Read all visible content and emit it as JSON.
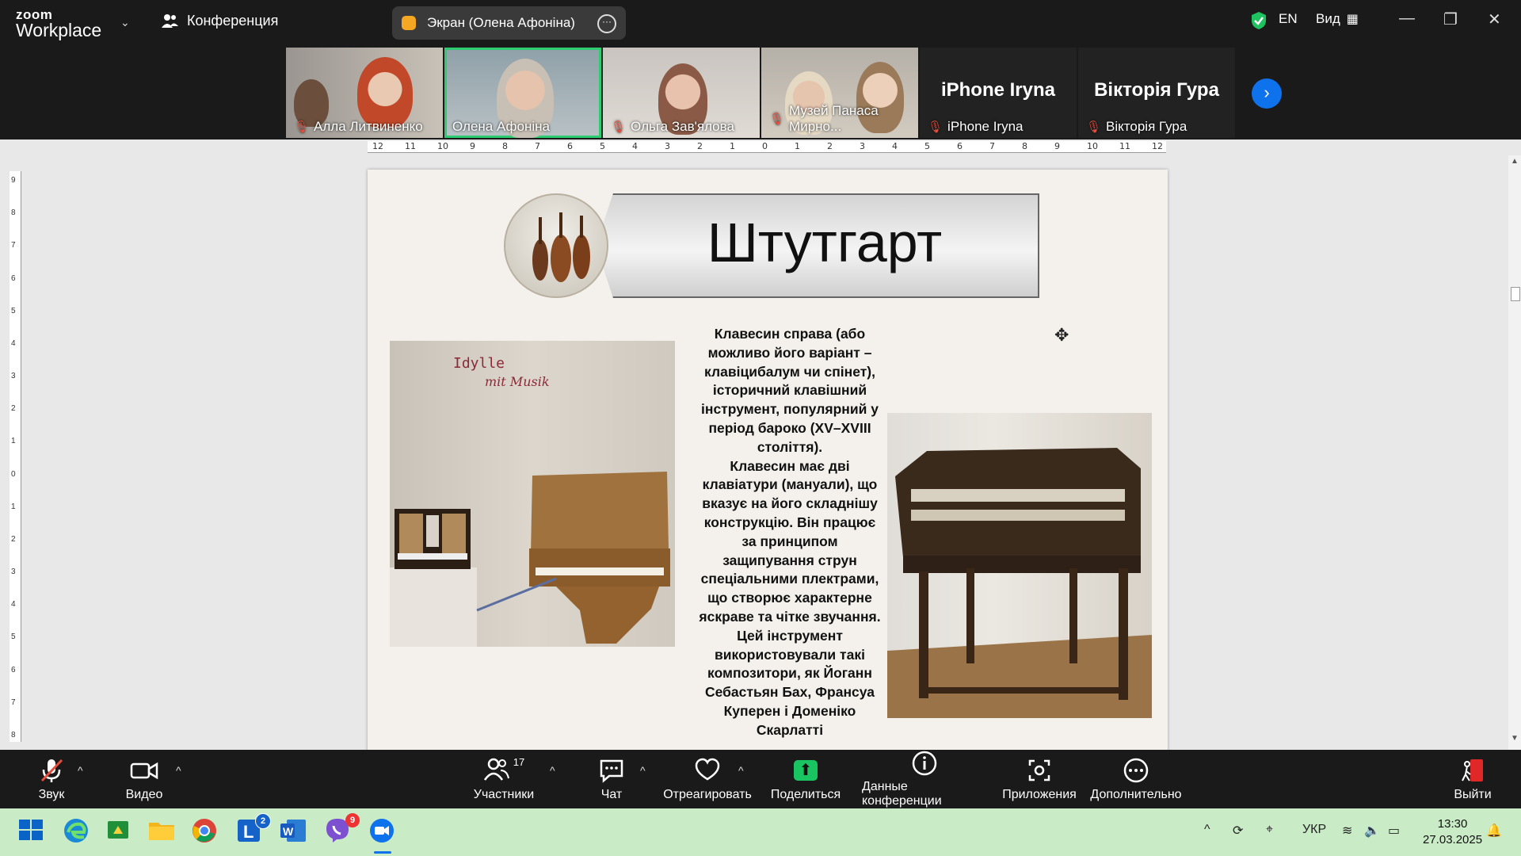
{
  "app": {
    "logo_line1": "zoom",
    "logo_line2": "Workplace",
    "meeting_label": "Конференция",
    "share_pill_text": "Экран (Олена Афоніна)",
    "language": "EN",
    "view_label": "Вид"
  },
  "participants": [
    {
      "name": "Алла Литвиненко",
      "muted": true,
      "video": true
    },
    {
      "name": "Олена Афоніна",
      "muted": false,
      "video": true,
      "active": true
    },
    {
      "name": "Ольга Зав'ялова",
      "muted": true,
      "video": true
    },
    {
      "name": "Музей Панаса Мирно...",
      "muted": true,
      "video": true
    },
    {
      "name": "iPhone Iryna",
      "muted": true,
      "video": false,
      "display": "iPhone Iryna"
    },
    {
      "name": "Вікторія Гура",
      "muted": true,
      "video": false,
      "display": "Вікторія Гура"
    }
  ],
  "document": {
    "title": "Штутгарт",
    "photo_caption_1": "Idylle",
    "photo_caption_2": "mit Musik",
    "body_lines": [
      "Клавесин справа (або",
      "можливо його варіант –",
      "клавіцибалум чи спінет),",
      "історичний клавішний",
      "інструмент, популярний у",
      "період бароко (XV–XVIII",
      "століття).",
      "Клавесин має дві",
      "клавіатури (мануали), що",
      "вказує на його складнішу",
      "конструкцію. Він працює",
      "за принципом",
      "защипування струн",
      "спеціальними плектрами,",
      "що створює характерне",
      "яскраве та чітке звучання.",
      "Цей інструмент",
      "використовували такі",
      "композитори, як Йоганн",
      "Себастьян Бах, Франсуа",
      "Куперен і Доменіко",
      "Скарлатті"
    ]
  },
  "ruler": {
    "h_ticks": [
      "12",
      "11",
      "10",
      "9",
      "8",
      "7",
      "6",
      "5",
      "4",
      "3",
      "2",
      "1",
      "0",
      "1",
      "2",
      "3",
      "4",
      "5",
      "6",
      "7",
      "8",
      "9",
      "10",
      "11",
      "12"
    ],
    "v_ticks": [
      "9",
      "8",
      "7",
      "6",
      "5",
      "4",
      "3",
      "2",
      "1",
      "0",
      "1",
      "2",
      "3",
      "4",
      "5",
      "6",
      "7",
      "8"
    ]
  },
  "toolbar": {
    "audio_label": "Звук",
    "video_label": "Видео",
    "participants_label": "Участники",
    "participants_count": "17",
    "chat_label": "Чат",
    "react_label": "Отреагировать",
    "share_label": "Поделиться",
    "info_label": "Данные конференции",
    "apps_label": "Приложения",
    "more_label": "Дополнительно",
    "leave_label": "Выйти"
  },
  "taskbar": {
    "word_badge": "2",
    "viber_badge": "9",
    "lang": "УКР",
    "time": "13:30",
    "date": "27.03.2025"
  },
  "colors": {
    "active_border": "#2ecc71",
    "muted": "#e74c3c",
    "share_green": "#18c561",
    "accent_blue": "#0e72ed",
    "taskbar_bg": "#c9ebc6"
  }
}
